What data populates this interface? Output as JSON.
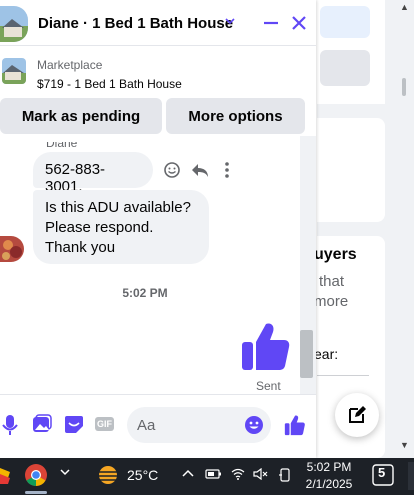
{
  "chat": {
    "title": "Diane · 1 Bed 1 Bath House",
    "listing_category": "Marketplace",
    "listing_item": "$719 - 1 Bed 1 Bath House",
    "actions": {
      "mark_pending": "Mark as pending",
      "more_options": "More options"
    },
    "sender_name_cut": "Diane",
    "messages": [
      {
        "text": "562-883-3001."
      },
      {
        "text": "Is this ADU available? Please respond. Thank you"
      }
    ],
    "timestamp": "5:02 PM",
    "sent_status": "Sent",
    "composer_placeholder": "Aa",
    "gif_label": "GIF",
    "accent_color": "#6047f5"
  },
  "background_page": {
    "heading_fragment": "uyers",
    "line1": "that",
    "line2": "more",
    "line3": "ear:"
  },
  "taskbar": {
    "temperature": "25°C",
    "time": "5:02 PM",
    "date": "2/1/2025",
    "notification_count": "5"
  }
}
